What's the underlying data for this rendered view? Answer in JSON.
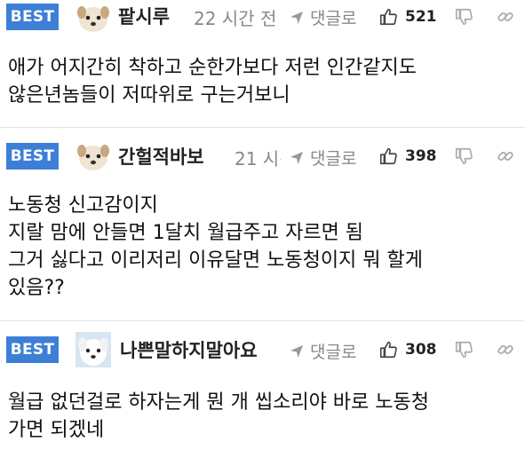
{
  "badge_label": "BEST",
  "comments": [
    {
      "nickname": "팥시루",
      "time": "22 시간 전",
      "reply_label": "댓글로",
      "likes": "521",
      "text": "애가 어지간히 착하고 순한가보다 저런 인간같지도\n않은년놈들이 저따위로 구는거보니",
      "avatar_icon": "dog-avatar-icon"
    },
    {
      "nickname": "간헐적바보",
      "time": "21 시간 전",
      "reply_label": "댓글로",
      "likes": "398",
      "text": "노동청 신고감이지\n지랄 맘에 안들면 1달치 월급주고 자르면 됨\n그거 싫다고 이리저리 이유달면 노동청이지 뭐 할게\n있음??",
      "avatar_icon": "dog-avatar-icon"
    },
    {
      "nickname": "나쁜말하지말아요",
      "time": "",
      "reply_label": "댓글로",
      "likes": "308",
      "text": "월급 없던걸로 하자는게 뭔 개 씹소리야 바로 노동청\n가면 되겠네",
      "avatar_icon": "puppy-avatar-icon"
    }
  ],
  "colors": {
    "badge": "#3d7fd6",
    "muted": "#888888",
    "divider": "#e2e2e2"
  }
}
